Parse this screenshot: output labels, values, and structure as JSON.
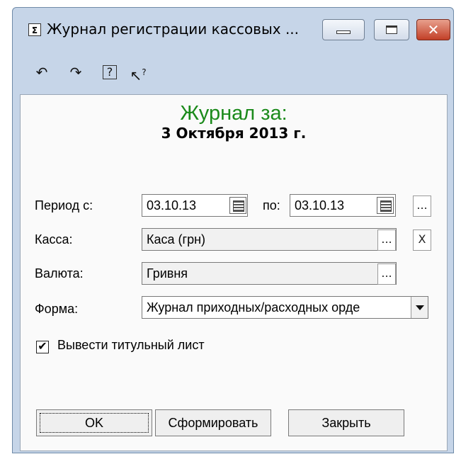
{
  "window": {
    "title": "Журнал регистрации кассовых ...",
    "icon": "sigma-icon"
  },
  "toolbar": {
    "items": [
      "undo-icon",
      "redo-icon",
      "help-icon",
      "whats-this-icon"
    ]
  },
  "header": {
    "title": "Журнал за:",
    "date": "3 Октября 2013 г."
  },
  "form": {
    "period_label": "Период с:",
    "date_from": "03.10.13",
    "to_label": "по:",
    "date_to": "03.10.13",
    "cash_label": "Касса:",
    "cash_value": "Каса (грн)",
    "currency_label": "Валюта:",
    "currency_value": "Гривня",
    "form_label": "Форма:",
    "form_value": "Журнал приходных/расходных орде",
    "checkbox_label": "Вывести титульный лист",
    "checkbox_checked": true
  },
  "buttons": {
    "ok": "OK",
    "generate": "Сформировать",
    "close": "Закрыть"
  },
  "glyphs": {
    "ellipsis": "...",
    "clear": "X",
    "check": "✔"
  }
}
